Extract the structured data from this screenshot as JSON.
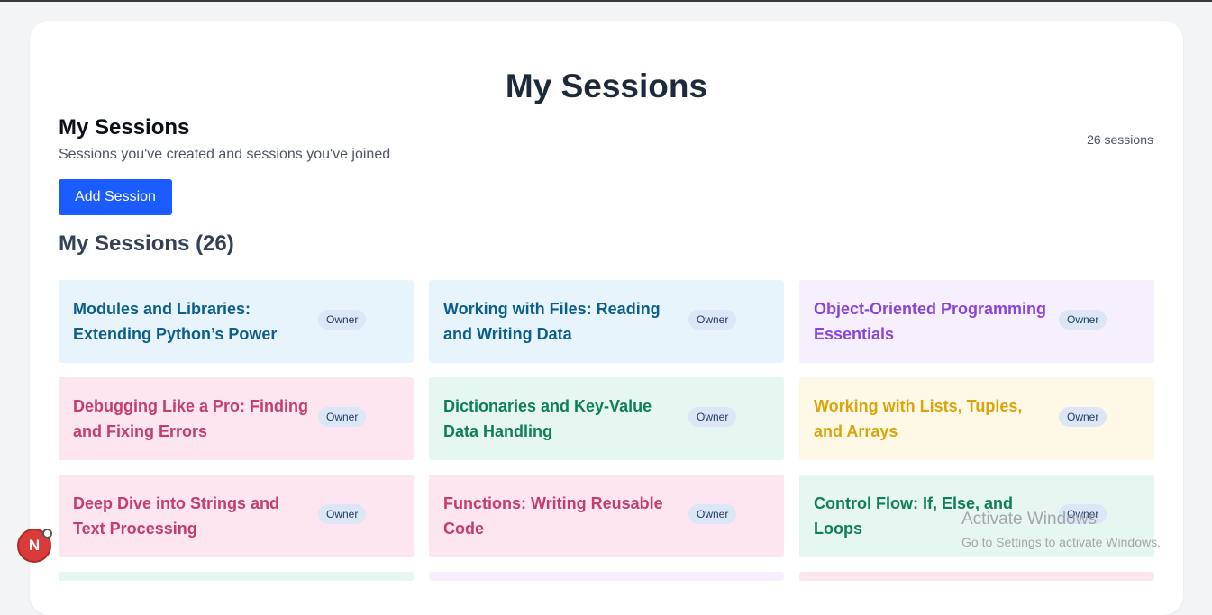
{
  "page_title": "My Sessions",
  "section": {
    "title": "My Sessions",
    "subtitle": "Sessions you've created and sessions you've joined",
    "count_label": "26 sessions",
    "add_button_label": "Add Session"
  },
  "list_title": "My Sessions (26)",
  "sessions": [
    {
      "title": "Modules and Libraries: Extending Python’s Power",
      "badge": "Owner",
      "theme": "blue"
    },
    {
      "title": "Working with Files: Reading and Writing Data",
      "badge": "Owner",
      "theme": "blue"
    },
    {
      "title": "Object-Oriented Programming Essentials",
      "badge": "Owner",
      "theme": "purple"
    },
    {
      "title": "Debugging Like a Pro: Finding and Fixing Errors",
      "badge": "Owner",
      "theme": "pink"
    },
    {
      "title": "Dictionaries and Key-Value Data Handling",
      "badge": "Owner",
      "theme": "green"
    },
    {
      "title": "Working with Lists, Tuples, and Arrays",
      "badge": "Owner",
      "theme": "yellow"
    },
    {
      "title": "Deep Dive into Strings and Text Processing",
      "badge": "Owner",
      "theme": "pink"
    },
    {
      "title": "Functions: Writing Reusable Code",
      "badge": "Owner",
      "theme": "pink"
    },
    {
      "title": "Control Flow: If, Else, and Loops",
      "badge": "Owner",
      "theme": "green"
    }
  ],
  "next_row_themes": [
    "green",
    "purple",
    "pink"
  ],
  "avatar_letter": "N",
  "watermark": {
    "line1": "Activate Windows",
    "line2": "Go to Settings to activate Windows."
  }
}
